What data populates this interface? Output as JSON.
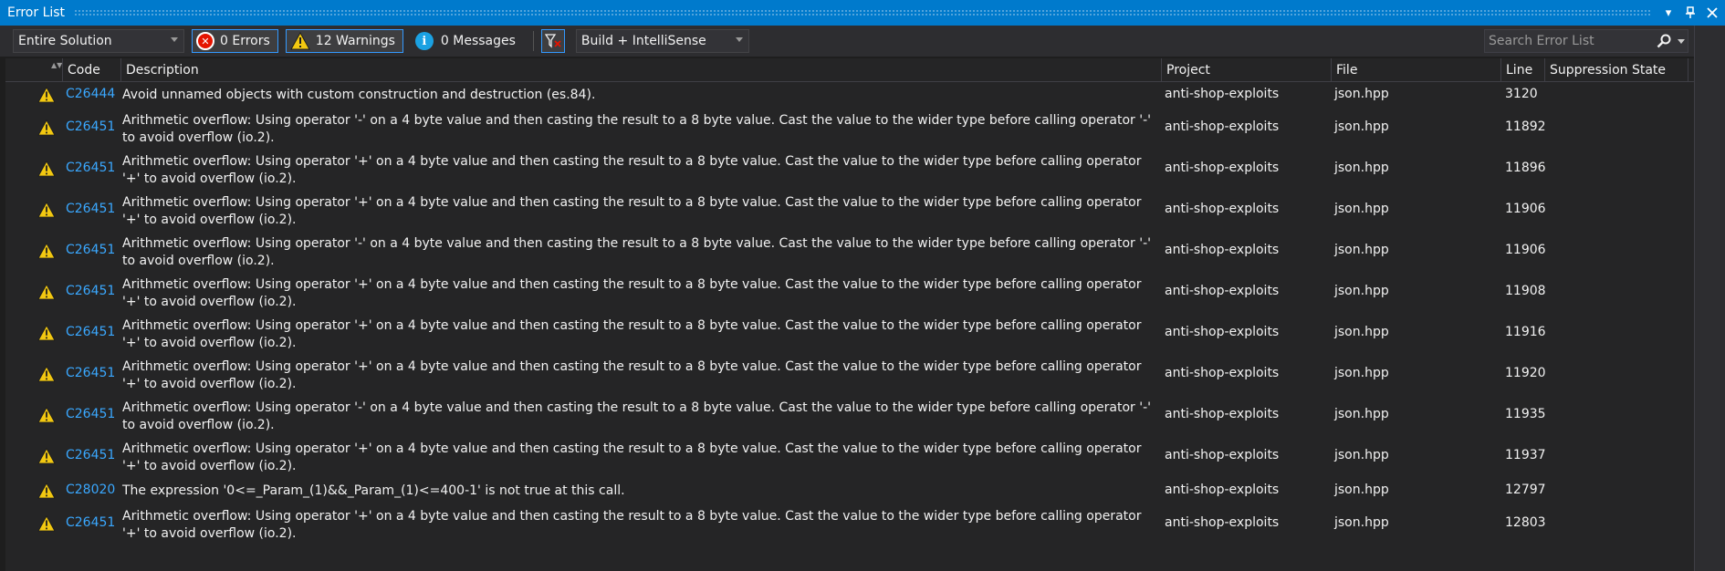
{
  "window": {
    "title": "Error List"
  },
  "toolbar": {
    "scope": "Entire Solution",
    "errors": "0 Errors",
    "warnings": "12 Warnings",
    "messages": "0 Messages",
    "source": "Build + IntelliSense",
    "search_placeholder": "Search Error List"
  },
  "columns": {
    "code": "Code",
    "description": "Description",
    "project": "Project",
    "file": "File",
    "line": "Line",
    "suppression": "Suppression State"
  },
  "rows": [
    {
      "code": "C26444",
      "desc": "Avoid unnamed objects with custom construction and destruction (es.84).",
      "project": "anti-shop-exploits",
      "file": "json.hpp",
      "line": "3120"
    },
    {
      "code": "C26451",
      "desc": "Arithmetic overflow: Using operator '-' on a 4 byte value and then casting the result to a 8 byte value. Cast the value to the wider type before calling operator '-' to avoid overflow (io.2).",
      "project": "anti-shop-exploits",
      "file": "json.hpp",
      "line": "11892"
    },
    {
      "code": "C26451",
      "desc": "Arithmetic overflow: Using operator '+' on a 4 byte value and then casting the result to a 8 byte value. Cast the value to the wider type before calling operator '+' to avoid overflow (io.2).",
      "project": "anti-shop-exploits",
      "file": "json.hpp",
      "line": "11896"
    },
    {
      "code": "C26451",
      "desc": "Arithmetic overflow: Using operator '+' on a 4 byte value and then casting the result to a 8 byte value. Cast the value to the wider type before calling operator '+' to avoid overflow (io.2).",
      "project": "anti-shop-exploits",
      "file": "json.hpp",
      "line": "11906"
    },
    {
      "code": "C26451",
      "desc": "Arithmetic overflow: Using operator '-' on a 4 byte value and then casting the result to a 8 byte value. Cast the value to the wider type before calling operator '-' to avoid overflow (io.2).",
      "project": "anti-shop-exploits",
      "file": "json.hpp",
      "line": "11906"
    },
    {
      "code": "C26451",
      "desc": "Arithmetic overflow: Using operator '+' on a 4 byte value and then casting the result to a 8 byte value. Cast the value to the wider type before calling operator '+' to avoid overflow (io.2).",
      "project": "anti-shop-exploits",
      "file": "json.hpp",
      "line": "11908"
    },
    {
      "code": "C26451",
      "desc": "Arithmetic overflow: Using operator '+' on a 4 byte value and then casting the result to a 8 byte value. Cast the value to the wider type before calling operator '+' to avoid overflow (io.2).",
      "project": "anti-shop-exploits",
      "file": "json.hpp",
      "line": "11916"
    },
    {
      "code": "C26451",
      "desc": "Arithmetic overflow: Using operator '+' on a 4 byte value and then casting the result to a 8 byte value. Cast the value to the wider type before calling operator '+' to avoid overflow (io.2).",
      "project": "anti-shop-exploits",
      "file": "json.hpp",
      "line": "11920"
    },
    {
      "code": "C26451",
      "desc": "Arithmetic overflow: Using operator '-' on a 4 byte value and then casting the result to a 8 byte value. Cast the value to the wider type before calling operator '-' to avoid overflow (io.2).",
      "project": "anti-shop-exploits",
      "file": "json.hpp",
      "line": "11935"
    },
    {
      "code": "C26451",
      "desc": "Arithmetic overflow: Using operator '+' on a 4 byte value and then casting the result to a 8 byte value. Cast the value to the wider type before calling operator '+' to avoid overflow (io.2).",
      "project": "anti-shop-exploits",
      "file": "json.hpp",
      "line": "11937"
    },
    {
      "code": "C28020",
      "desc": "The expression '0<=_Param_(1)&&_Param_(1)<=400-1' is not true at this call.",
      "project": "anti-shop-exploits",
      "file": "json.hpp",
      "line": "12797"
    },
    {
      "code": "C26451",
      "desc": "Arithmetic overflow: Using operator '+' on a 4 byte value and then casting the result to a 8 byte value. Cast the value to the wider type before calling operator '+' to avoid overflow (io.2).",
      "project": "anti-shop-exploits",
      "file": "json.hpp",
      "line": "12803"
    }
  ],
  "colors": {
    "accent": "#007acc",
    "link": "#3aa8ff",
    "warning": "#f2c811",
    "error": "#e51400",
    "info": "#1ba1e2"
  },
  "icons": {
    "error": "error-circle-icon",
    "warning": "warning-triangle-icon",
    "info": "info-circle-icon"
  }
}
